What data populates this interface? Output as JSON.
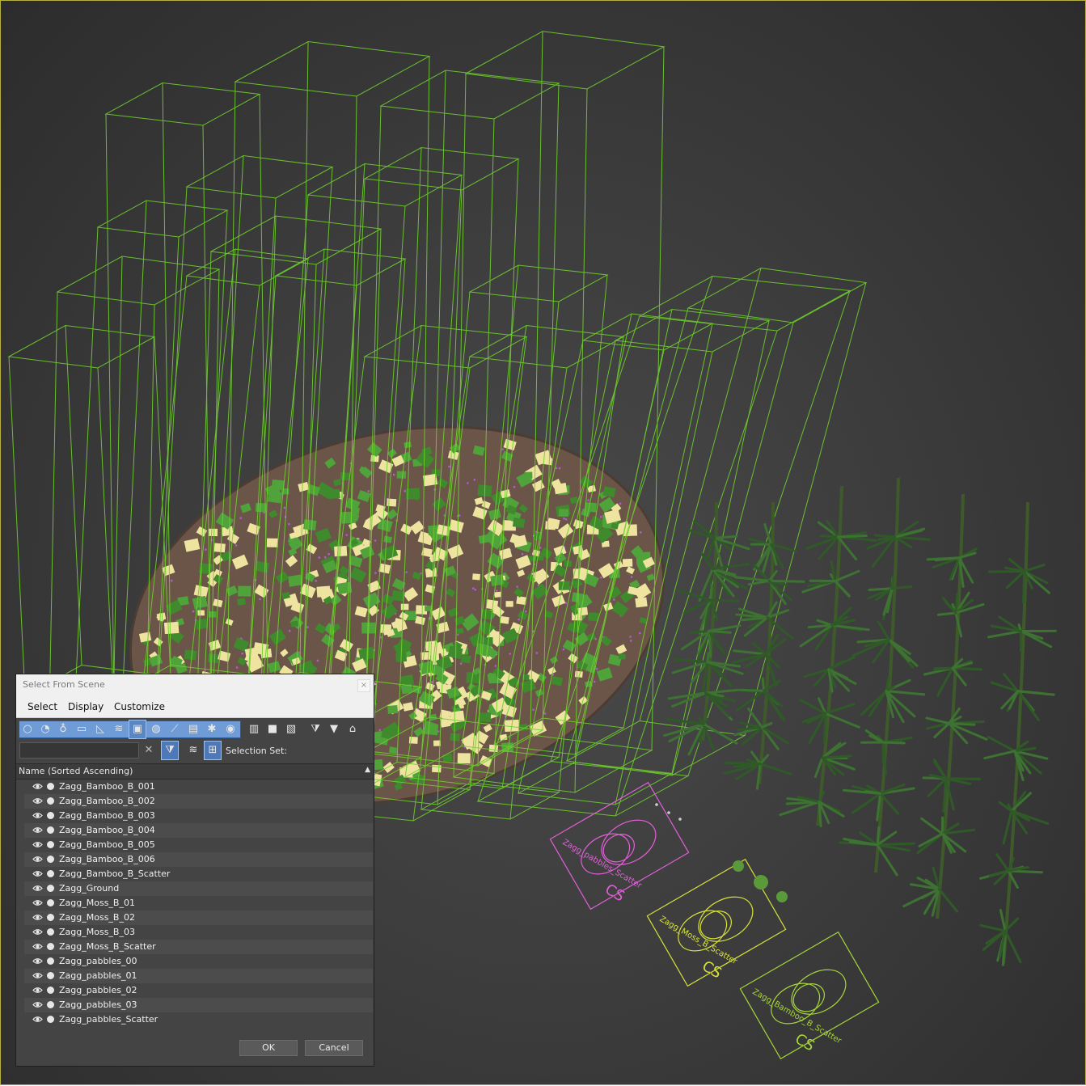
{
  "dialog": {
    "title": "Select From Scene",
    "close_glyph": "×",
    "menu": [
      "Select",
      "Display",
      "Customize"
    ],
    "toolbar_icons": [
      "geometry-icon",
      "shapes-icon",
      "lights-icon",
      "cameras-icon",
      "helpers-icon",
      "space-warps-icon",
      "groups-icon",
      "xrefs-icon",
      "bones-icon",
      "containers-icon",
      "frozen-icon",
      "hidden-icon",
      "display-all-icon",
      "display-none-icon",
      "invert-display-icon",
      "filter-icon",
      "find-icon",
      "selection-sets-icon"
    ],
    "filter_placeholder": "",
    "clear_glyph": "✕",
    "selection_set_label": "Selection Set:",
    "column_header": "Name (Sorted Ascending)",
    "sort_glyph": "▲",
    "items": [
      "Zagg_Bamboo_B_001",
      "Zagg_Bamboo_B_002",
      "Zagg_Bamboo_B_003",
      "Zagg_Bamboo_B_004",
      "Zagg_Bamboo_B_005",
      "Zagg_Bamboo_B_006",
      "Zagg_Bamboo_B_Scatter",
      "Zagg_Ground",
      "Zagg_Moss_B_01",
      "Zagg_Moss_B_02",
      "Zagg_Moss_B_03",
      "Zagg_Moss_B_Scatter",
      "Zagg_pabbles_00",
      "Zagg_pabbles_01",
      "Zagg_pabbles_02",
      "Zagg_pabbles_03",
      "Zagg_pabbles_Scatter"
    ],
    "ok_label": "OK",
    "cancel_label": "Cancel"
  },
  "viewport": {
    "scatter_labels": [
      "Zagg_pabbles_Scatter",
      "Zagg_Moss_B_Scatter",
      "Zagg_Bamboo_B_Scatter"
    ],
    "cs_label": "CS",
    "colors": {
      "wireframe": "#6fcf2e",
      "pebbles_scatter": "#e060d8",
      "moss_scatter": "#d8e23a",
      "bamboo_scatter": "#a6d63a",
      "ground": "#6b5548",
      "moss": "#3f8a2c",
      "pebble": "#efe3a0",
      "bamboo_stalk": "#3f5a2a",
      "bamboo_leaf": "#2f5a28"
    }
  }
}
